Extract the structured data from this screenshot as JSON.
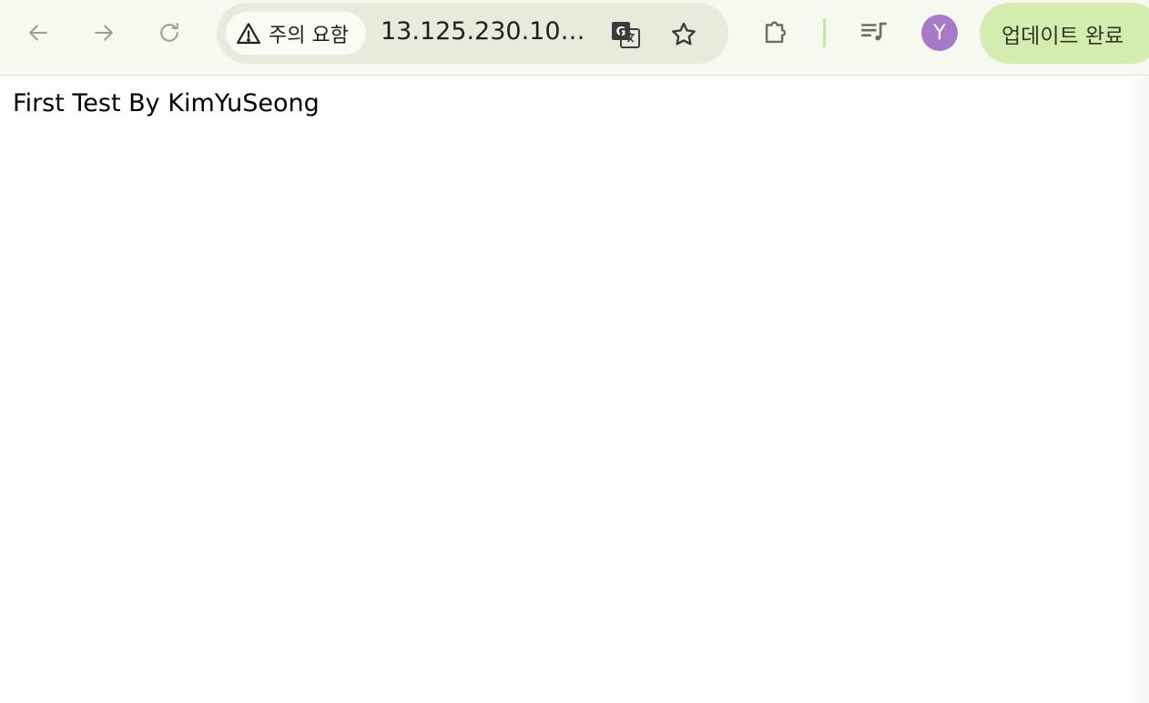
{
  "toolbar": {
    "back_icon": "arrow-left-icon",
    "forward_icon": "arrow-right-icon",
    "reload_icon": "reload-icon"
  },
  "omnibox": {
    "security_label": "주의 요함",
    "security_icon": "warning-triangle-icon",
    "url": "13.125.230.105...",
    "translate_icon": "translate-icon",
    "bookmark_icon": "star-icon"
  },
  "actions": {
    "extensions_icon": "puzzle-icon",
    "media_icon": "media-queue-icon",
    "avatar_initial": "Y",
    "update_label": "업데이트 완료"
  },
  "colors": {
    "toolbar_bg": "#f7f8ef",
    "omnibox_bg": "#e8eadb",
    "avatar_bg": "#a679c9",
    "update_bg": "#d4ecb0"
  },
  "page": {
    "body_text": "First Test By KimYuSeong"
  }
}
